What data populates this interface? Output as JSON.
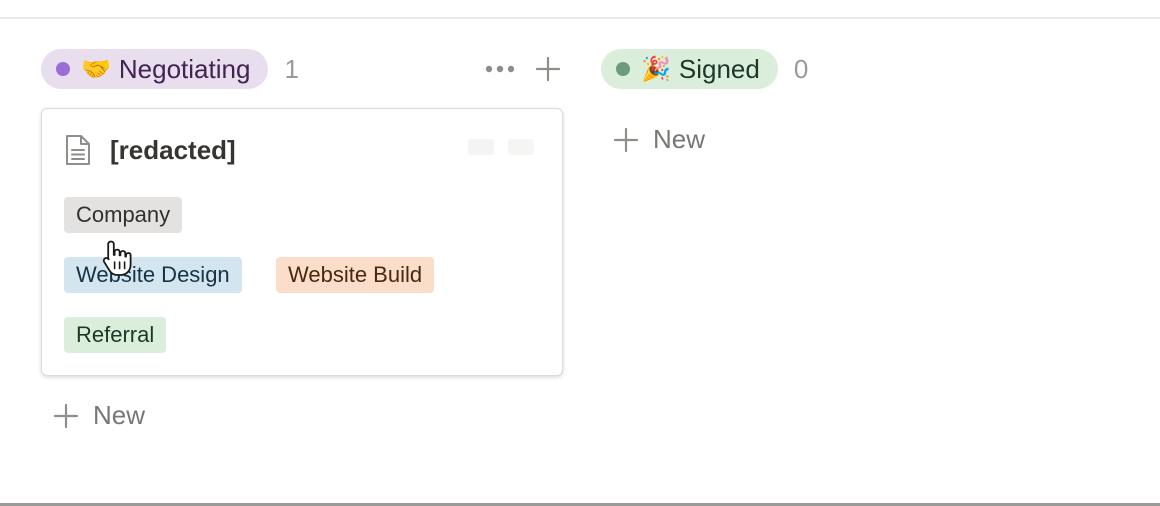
{
  "board": {
    "columns": [
      {
        "status": "Negotiating",
        "emoji": "🤝",
        "dot_color": "#9a6dd7",
        "count": "1",
        "more_icon": "more-horizontal-icon",
        "add_icon": "plus-icon",
        "cards": [
          {
            "icon": "page-icon",
            "title": "[redacted]",
            "tags": [
              {
                "label": "Company",
                "color": "#e3e2e0"
              },
              {
                "label": "Website Design",
                "color": "#d3e5ef"
              },
              {
                "label": "Website Build",
                "color": "#fadec9"
              },
              {
                "label": "Referral",
                "color": "#dbeddb"
              }
            ]
          }
        ],
        "new_label": "New"
      },
      {
        "status": "Signed",
        "emoji": "🎉",
        "dot_color": "#6c9b7d",
        "count": "0",
        "new_label": "New"
      }
    ]
  },
  "cursor_icon": "hand-pointer-icon"
}
